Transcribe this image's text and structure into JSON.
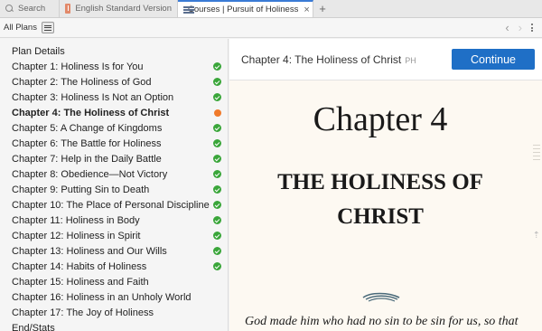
{
  "tabs": [
    {
      "label": "Search",
      "icon": "search-icon"
    },
    {
      "label": "English Standard Version",
      "icon": "bible-icon"
    },
    {
      "label": "Courses | Pursuit of Holiness",
      "icon": "course-icon",
      "active": true
    }
  ],
  "new_tab_symbol": "+",
  "tab_close_symbol": "×",
  "toolbar": {
    "all_plans_label": "All Plans",
    "back_symbol": "‹",
    "forward_symbol": "›"
  },
  "sidebar": {
    "plan_details_label": "Plan Details",
    "chapters": [
      {
        "label": "Chapter 1: Holiness Is for You",
        "status": "complete"
      },
      {
        "label": "Chapter 2: The Holiness of God",
        "status": "complete"
      },
      {
        "label": "Chapter 3: Holiness Is Not an Option",
        "status": "complete"
      },
      {
        "label": "Chapter 4: The Holiness of Christ",
        "status": "current"
      },
      {
        "label": "Chapter 5: A Change of Kingdoms",
        "status": "complete"
      },
      {
        "label": "Chapter 6: The Battle for Holiness",
        "status": "complete"
      },
      {
        "label": "Chapter 7: Help in the Daily Battle",
        "status": "complete"
      },
      {
        "label": "Chapter 8: Obedience—Not Victory",
        "status": "complete"
      },
      {
        "label": "Chapter 9: Putting Sin to Death",
        "status": "complete"
      },
      {
        "label": "Chapter 10: The Place of Personal Discipline",
        "status": "complete"
      },
      {
        "label": "Chapter 11: Holiness in Body",
        "status": "complete"
      },
      {
        "label": "Chapter 12: Holiness in Spirit",
        "status": "complete"
      },
      {
        "label": "Chapter 13: Holiness and Our Wills",
        "status": "complete"
      },
      {
        "label": "Chapter 14: Habits of Holiness",
        "status": "complete"
      },
      {
        "label": "Chapter 15: Holiness and Faith",
        "status": "none"
      },
      {
        "label": "Chapter 16: Holiness in an Unholy World",
        "status": "none"
      },
      {
        "label": "Chapter 17: The Joy of Holiness",
        "status": "none"
      },
      {
        "label": "End/Stats",
        "status": "none"
      }
    ]
  },
  "main": {
    "lesson_title": "Chapter 4: The Holiness of Christ",
    "lesson_tag": "PH",
    "continue_label": "Continue",
    "chapter_number": "Chapter 4",
    "chapter_heading": "THE HOLINESS OF CHRIST",
    "body_text": "God made him who had no sin to be sin for us, so that"
  },
  "colors": {
    "accent": "#1f6fc6",
    "complete": "#3aa63a",
    "current": "#f07a2a"
  }
}
